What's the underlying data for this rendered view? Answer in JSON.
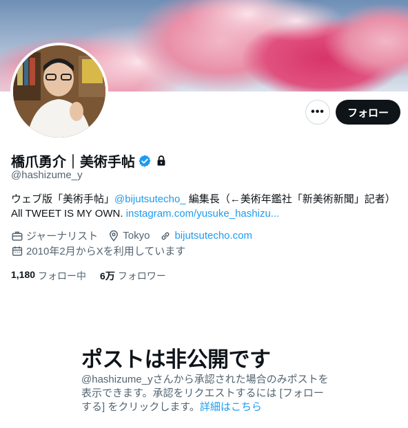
{
  "profile": {
    "display_name": "橋爪勇介｜美術手帖",
    "handle": "@hashizume_y",
    "bio": {
      "part1": "ウェブ版「美術手帖」",
      "mention": "@bijutsutecho_",
      "part2": " 編集長（←美術年鑑社「新美術新聞」記者）",
      "part3": "All TWEET IS MY OWN. ",
      "link": "instagram.com/yusuke_hashizu..."
    },
    "meta": {
      "profession": "ジャーナリスト",
      "location": "Tokyo",
      "website": "bijutsutecho.com",
      "joined": "2010年2月からXを利用しています"
    },
    "stats": {
      "following_count": "1,180",
      "following_label": "フォロー中",
      "followers_count": "6万",
      "followers_label": "フォロワー"
    }
  },
  "actions": {
    "more_label": "•••",
    "follow_label": "フォロー"
  },
  "private_notice": {
    "title": "ポストは非公開です",
    "desc_part1": "@hashizume_yさんから承認された場合のみポストを表示できます。承認をリクエストするには [フォロー する] をクリックします。",
    "desc_link": "詳細はこちら"
  },
  "icons": {
    "verified": "verified-badge-icon",
    "lock": "lock-icon",
    "profession": "briefcase-icon",
    "location": "location-pin-icon",
    "website": "link-icon",
    "joined": "calendar-icon"
  },
  "colors": {
    "accent": "#1d9bf0",
    "text": "#0f1419",
    "muted": "#536471",
    "button_dark": "#0f1419"
  }
}
